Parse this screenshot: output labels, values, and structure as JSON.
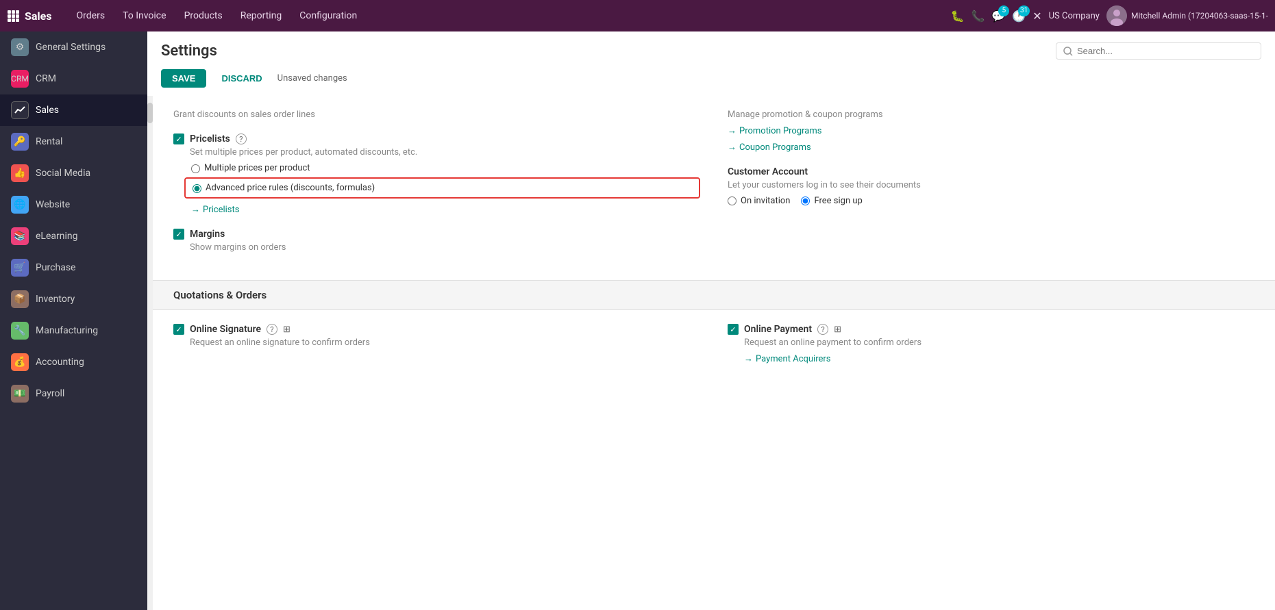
{
  "navbar": {
    "grid_icon": "⊞",
    "brand": "Sales",
    "menu": [
      "Orders",
      "To Invoice",
      "Products",
      "Reporting",
      "Configuration"
    ],
    "icons": {
      "bug": "🐛",
      "phone": "📞",
      "chat": "💬",
      "chat_badge": "5",
      "clock": "🕐",
      "clock_badge": "31",
      "close": "✕"
    },
    "company": "US Company",
    "user": "Mitchell Admin (17204063-saas-15-1-"
  },
  "sidebar": {
    "items": [
      {
        "id": "general-settings",
        "label": "General Settings",
        "icon": "⚙",
        "icon_class": "icon-settings"
      },
      {
        "id": "crm",
        "label": "CRM",
        "icon": "👤",
        "icon_class": "icon-crm"
      },
      {
        "id": "sales",
        "label": "Sales",
        "icon": "📈",
        "icon_class": "icon-sales",
        "active": true
      },
      {
        "id": "rental",
        "label": "Rental",
        "icon": "🔑",
        "icon_class": "icon-rental"
      },
      {
        "id": "social-media",
        "label": "Social Media",
        "icon": "👍",
        "icon_class": "icon-social"
      },
      {
        "id": "website",
        "label": "Website",
        "icon": "🌐",
        "icon_class": "icon-website"
      },
      {
        "id": "elearning",
        "label": "eLearning",
        "icon": "📚",
        "icon_class": "icon-elearning"
      },
      {
        "id": "purchase",
        "label": "Purchase",
        "icon": "🛒",
        "icon_class": "icon-purchase"
      },
      {
        "id": "inventory",
        "label": "Inventory",
        "icon": "📦",
        "icon_class": "icon-inventory"
      },
      {
        "id": "manufacturing",
        "label": "Manufacturing",
        "icon": "🔧",
        "icon_class": "icon-manufacturing"
      },
      {
        "id": "accounting",
        "label": "Accounting",
        "icon": "💰",
        "icon_class": "icon-accounting"
      },
      {
        "id": "payroll",
        "label": "Payroll",
        "icon": "💵",
        "icon_class": "icon-payroll"
      }
    ]
  },
  "settings": {
    "title": "Settings",
    "search_placeholder": "Search...",
    "save_label": "SAVE",
    "discard_label": "DISCARD",
    "unsaved_changes": "Unsaved changes"
  },
  "main_content": {
    "grant_discounts_desc": "Grant discounts on sales order lines",
    "manage_promo_desc": "Manage promotion & coupon programs",
    "promotion_programs_label": "Promotion Programs",
    "coupon_programs_label": "Coupon Programs",
    "pricelists_label": "Pricelists",
    "pricelists_help": "?",
    "pricelists_desc": "Set multiple prices per product, automated discounts, etc.",
    "multiple_prices_label": "Multiple prices per product",
    "advanced_price_label": "Advanced price rules (discounts, formulas)",
    "pricelists_link": "Pricelists",
    "margins_label": "Margins",
    "margins_desc": "Show margins on orders",
    "customer_account_title": "Customer Account",
    "customer_account_desc": "Let your customers log in to see their documents",
    "on_invitation_label": "On invitation",
    "free_signup_label": "Free sign up",
    "quotations_section_title": "Quotations & Orders",
    "online_signature_label": "Online Signature",
    "online_signature_help": "?",
    "online_signature_desc": "Request an online signature to confirm orders",
    "online_payment_label": "Online Payment",
    "online_payment_help": "?",
    "online_payment_desc": "Request an online payment to confirm orders",
    "payment_acquirers_label": "Payment Acquirers"
  }
}
